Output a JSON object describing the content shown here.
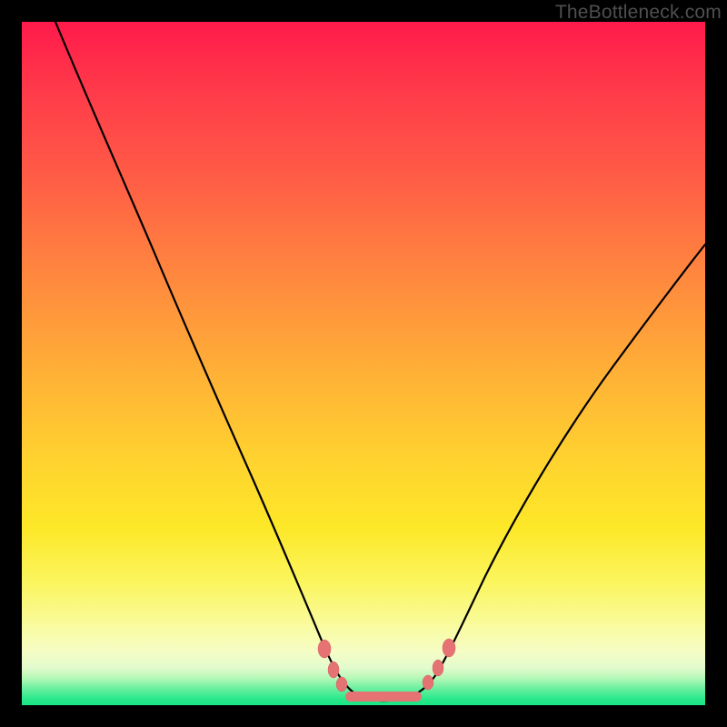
{
  "watermark": "TheBottleneck.com",
  "chart_data": {
    "type": "line",
    "title": "",
    "xlabel": "",
    "ylabel": "",
    "xlim": [
      0,
      100
    ],
    "ylim": [
      0,
      100
    ],
    "grid": false,
    "legend": false,
    "series": [
      {
        "name": "bottleneck-curve",
        "x": [
          5,
          10,
          15,
          20,
          25,
          30,
          35,
          40,
          44,
          47,
          50,
          53,
          56,
          59,
          62,
          66,
          72,
          80,
          90,
          100
        ],
        "y": [
          100,
          88,
          76,
          64,
          52,
          40,
          28,
          16,
          7,
          3,
          1,
          1,
          1,
          2,
          5,
          12,
          22,
          35,
          50,
          63
        ]
      }
    ],
    "markers": {
      "left_cluster": [
        {
          "x": 44.0,
          "y": 8.0
        },
        {
          "x": 45.5,
          "y": 5.0
        },
        {
          "x": 46.8,
          "y": 3.5
        }
      ],
      "right_cluster": [
        {
          "x": 59.5,
          "y": 3.0
        },
        {
          "x": 61.0,
          "y": 5.0
        },
        {
          "x": 62.5,
          "y": 8.0
        }
      ],
      "floor_band": {
        "x_start": 47.5,
        "x_end": 58.5,
        "y": 1.2
      }
    },
    "gradient_stops": [
      {
        "pct": 0,
        "color": "#ff1a4b"
      },
      {
        "pct": 50,
        "color": "#ffc030"
      },
      {
        "pct": 90,
        "color": "#f9fb9a"
      },
      {
        "pct": 100,
        "color": "#17e685"
      }
    ]
  }
}
